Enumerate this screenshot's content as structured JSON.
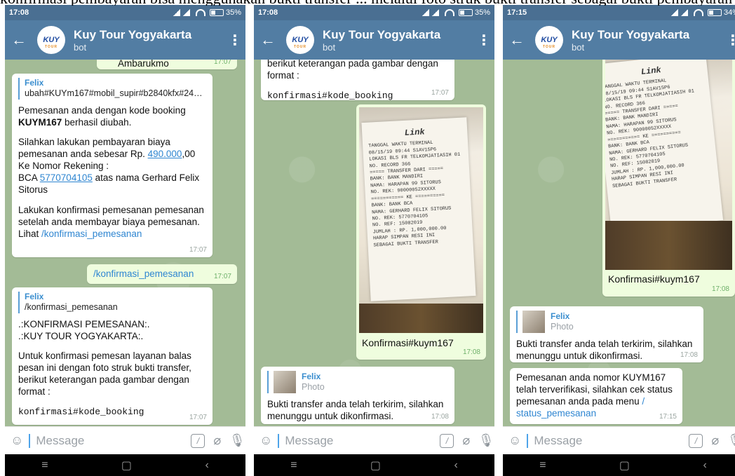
{
  "caption": "konfirmasi pembayaran bisa menggunakan bukti transfer ... melalui foto struk bukti transfer sebagai bukti pembayaran",
  "app": {
    "title": "Kuy Tour Yogyakarta",
    "subtitle": "bot",
    "avatar_text": "KUY",
    "avatar_sub": "TOUR"
  },
  "input": {
    "placeholder": "Message"
  },
  "screens": [
    {
      "status": {
        "time": "17:08",
        "battery": "35%"
      },
      "messages": [
        {
          "text": "Ambarukmo",
          "time": "17:07"
        },
        {
          "reply_name": "Felix",
          "reply_text": "ubah#KUYm167#mobil_supir#b2840kfx#24#2...",
          "p1_pre": "Pemesanan anda dengan kode booking ",
          "p1_bold": "KUYM167",
          "p1_post": " berhasil diubah.",
          "p2_pre": "Silahkan lakukan pembayaran biaya pemesanan anda sebesar Rp. ",
          "p2_amount": "490.000",
          "p2_mid": ",00 Ke Nomor Rekening :",
          "p2_bank": "BCA ",
          "p2_account": "5770704105",
          "p2_post": " atas nama Gerhard Felix Sitorus",
          "p3": "Lakukan konfirmasi pemesanan pemesanan setelah anda membayar biaya pemesanan.",
          "p3_lihat": "Lihat ",
          "p3_link": "/konfirmasi_pemesanan",
          "time": "17:07"
        },
        {
          "text": "/konfirmasi_pemesanan",
          "time": "17:07"
        },
        {
          "reply_name": "Felix",
          "reply_text": "/konfirmasi_pemesanan",
          "line1": ".:KONFIRMASI PEMESANAN:.",
          "line2": ".:KUY TOUR YOGYAKARTA:.",
          "body": "Untuk konfirmasi pemesan layanan balas pesan ini dengan foto struk bukti transfer, berikut keterangan pada gambar dengan format :",
          "code": "konfirmasi#kode_booking",
          "time": "17:07"
        }
      ]
    },
    {
      "status": {
        "time": "17:08",
        "battery": "35%"
      },
      "messages": [
        {
          "text": "berikut keterangan pada gambar dengan format :",
          "code": "konfirmasi#kode_booking",
          "time": "17:07"
        },
        {
          "caption": "Konfirmasi#kuym167",
          "time": "17:08"
        },
        {
          "reply_name": "Felix",
          "reply_text": "Photo",
          "text": "Bukti transfer anda telah terkirim, silahkan menunggu untuk dikonfirmasi.",
          "time": "17:08"
        }
      ]
    },
    {
      "status": {
        "time": "17:15",
        "battery": "34%"
      },
      "messages": [
        {
          "caption": "Konfirmasi#kuym167",
          "time": "17:08"
        },
        {
          "reply_name": "Felix",
          "reply_text": "Photo",
          "text": "Bukti transfer anda telah terkirim, silahkan menunggu untuk dikonfirmasi.",
          "time": "17:08"
        },
        {
          "text": "Pemesanan anda nomor KUYM167 telah terverifikasi, silahkan cek status pemesanan anda pada menu ",
          "link": "/ status_pemesanan",
          "time": "17:15"
        }
      ]
    }
  ],
  "receipt": {
    "logo": "Link",
    "lines": [
      "TANGGAL  WAKTU  TERMINAL",
      "08/15/19  09:44  S1AV15P6",
      "LOKASI  BLS FR TELKOMJATIASIH 01",
      "NO. RECORD  366",
      "===== TRANSFER DARI =====",
      "BANK: BANK MANDIRI",
      "NAMA: HARAPAN 99 SITORUS",
      "NO. REK: 90000052XXXXX",
      "=========== KE ==========",
      "BANK: BANK BCA",
      "NAMA: GERHARD FELIX SITORUS",
      "NO. REK: 5770704105",
      "NO. REF: 15082019",
      "JUMLAH : RP.    1,000,000.00",
      "HARAP SIMPAN RESI INI",
      "SEBAGAI BUKTI TRANSFER"
    ]
  }
}
